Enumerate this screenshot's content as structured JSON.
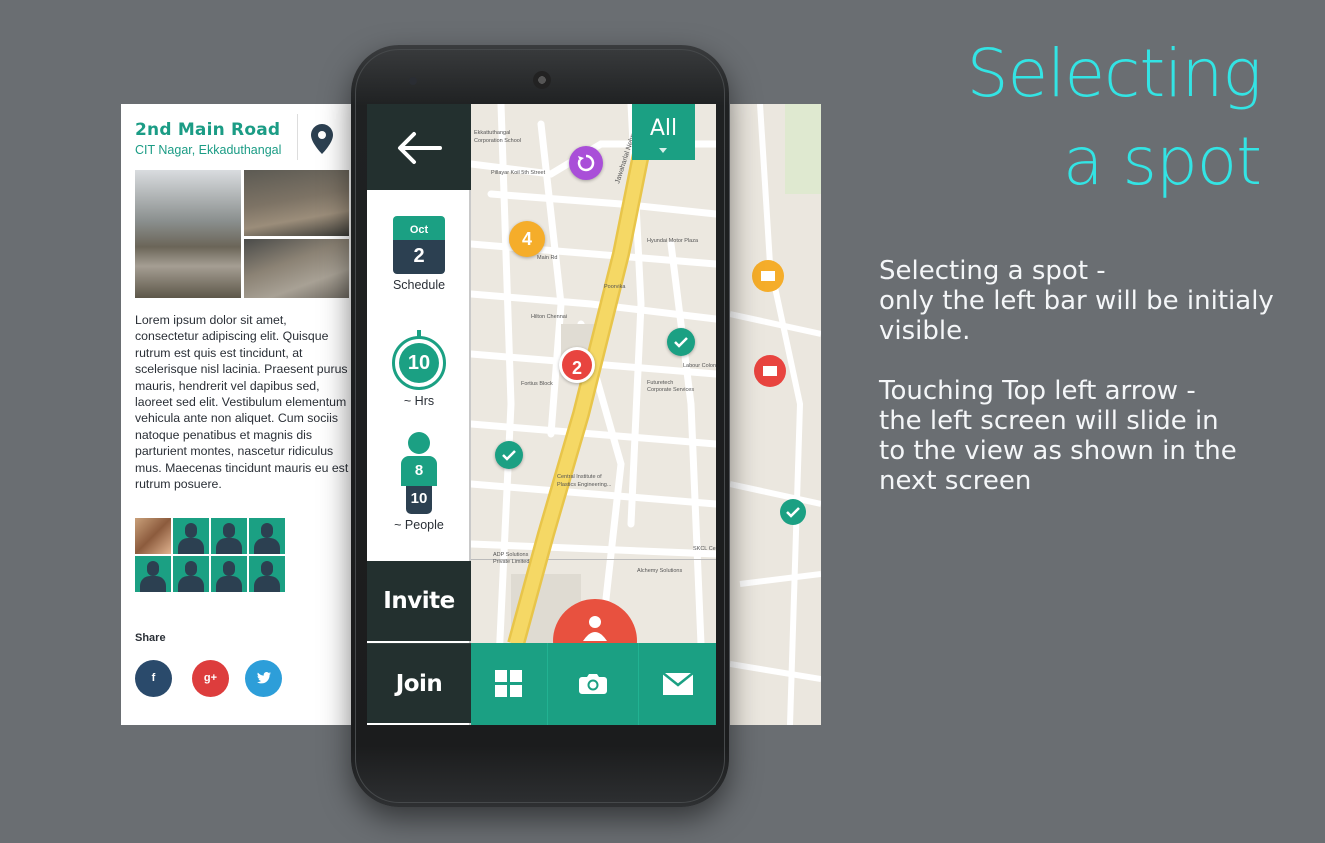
{
  "headline": {
    "line1": "Selecting",
    "line2": "a spot"
  },
  "description": {
    "para1": "Selecting a spot -\nonly the left bar will be initialy\nvisible.",
    "para2": "Touching Top left arrow -\nthe left screen will slide in\nto the view as shown in the\nnext screen"
  },
  "side_screen": {
    "title": "2nd Main Road",
    "subtitle": "CIT Nagar, Ekkaduthangal",
    "body": "Lorem ipsum dolor sit amet, consectetur adipiscing elit. Quisque rutrum est quis est tincidunt, at scelerisque nisl lacinia. Praesent purus mauris, hendrerit vel dapibus sed, laoreet sed elit. Vestibulum elementum vehicula ante non aliquet. Cum sociis natoque penatibus et magnis dis parturient montes, nascetur ridiculus mus. Maecenas tincidunt mauris eu est rutrum posuere.",
    "share_label": "Share",
    "social": {
      "facebook": "f",
      "googleplus": "g+",
      "twitter": "t"
    }
  },
  "left_bar": {
    "schedule": {
      "month": "Oct",
      "day": "2",
      "label": "Schedule"
    },
    "hours": {
      "value": "10",
      "label": "~ Hrs"
    },
    "people": {
      "current": "8",
      "total": "10",
      "label": "~ People"
    },
    "invite_label": "Invite",
    "join_label": "Join"
  },
  "map": {
    "filter_label": "All",
    "clusters": {
      "orange": "4",
      "red": "2"
    },
    "streets": [
      "Ekkattuthangal Corporation School",
      "Pillayar Koil 5th Street",
      "Jawaharlal Nehru Rd",
      "Main Rd",
      "Hilton Chennai",
      "Poorvika",
      "Fortius Block",
      "Futuretech Corporate Services",
      "Labour Colony",
      "Central Institute of Plastics Engineering...",
      "ADP Solutions Private Limited",
      "Alchemy Solutions",
      "Hyundai Motor Plaza",
      "SKCL Central"
    ]
  },
  "colors": {
    "accent": "#1ba083",
    "dark": "#23302f",
    "navy": "#2c4051",
    "red": "#e8513f",
    "headline": "#33e4e4"
  }
}
